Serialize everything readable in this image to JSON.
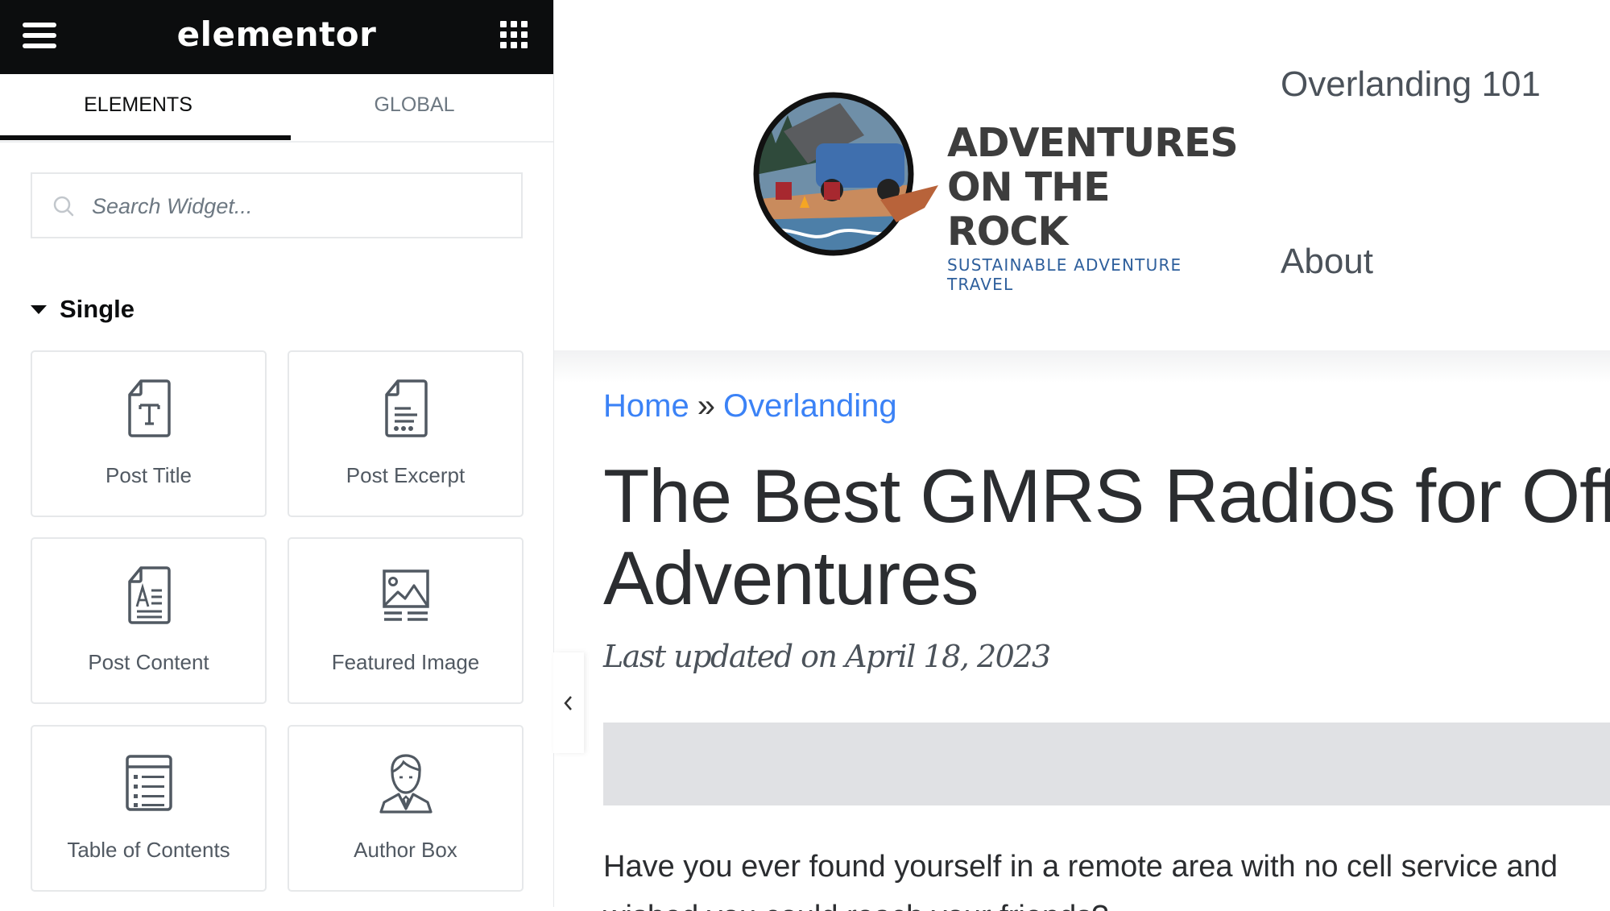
{
  "editor": {
    "app_name": "elementor",
    "menu_icon": "hamburger-icon",
    "apps_icon": "grid-icon",
    "tabs": [
      {
        "label": "ELEMENTS",
        "active": true
      },
      {
        "label": "GLOBAL",
        "active": false
      }
    ],
    "search": {
      "placeholder": "Search Widget...",
      "value": ""
    },
    "category": {
      "label": "Single",
      "expanded": true
    },
    "widgets": [
      {
        "label": "Post Title",
        "icon": "post-title-icon"
      },
      {
        "label": "Post Excerpt",
        "icon": "post-excerpt-icon"
      },
      {
        "label": "Post Content",
        "icon": "post-content-icon"
      },
      {
        "label": "Featured Image",
        "icon": "featured-image-icon"
      },
      {
        "label": "Table of Contents",
        "icon": "table-of-contents-icon"
      },
      {
        "label": "Author Box",
        "icon": "author-box-icon"
      }
    ],
    "collapse_icon": "chevron-left-icon"
  },
  "site": {
    "brand": {
      "line1": "ADVENTURES",
      "line2": "ON THE ROCK",
      "tagline": "SUSTAINABLE ADVENTURE TRAVEL"
    },
    "nav": [
      {
        "label": "Overlanding 101"
      },
      {
        "label": "About"
      }
    ],
    "breadcrumb": {
      "items": [
        {
          "label": "Home"
        },
        {
          "label": "Overlanding"
        }
      ],
      "separator": "»"
    },
    "post": {
      "title_line1": "The Best GMRS Radios for Off-Road",
      "title_line2": "Adventures",
      "date": "Last updated on April 18, 2023",
      "intro": "Have you ever found yourself in a remote area with no cell service and",
      "intro_next": "wished you could reach your friends?"
    },
    "colors": {
      "link": "#3b82f6",
      "editor_dark": "#0c0d0e",
      "tagline": "#2e5f9c"
    }
  }
}
